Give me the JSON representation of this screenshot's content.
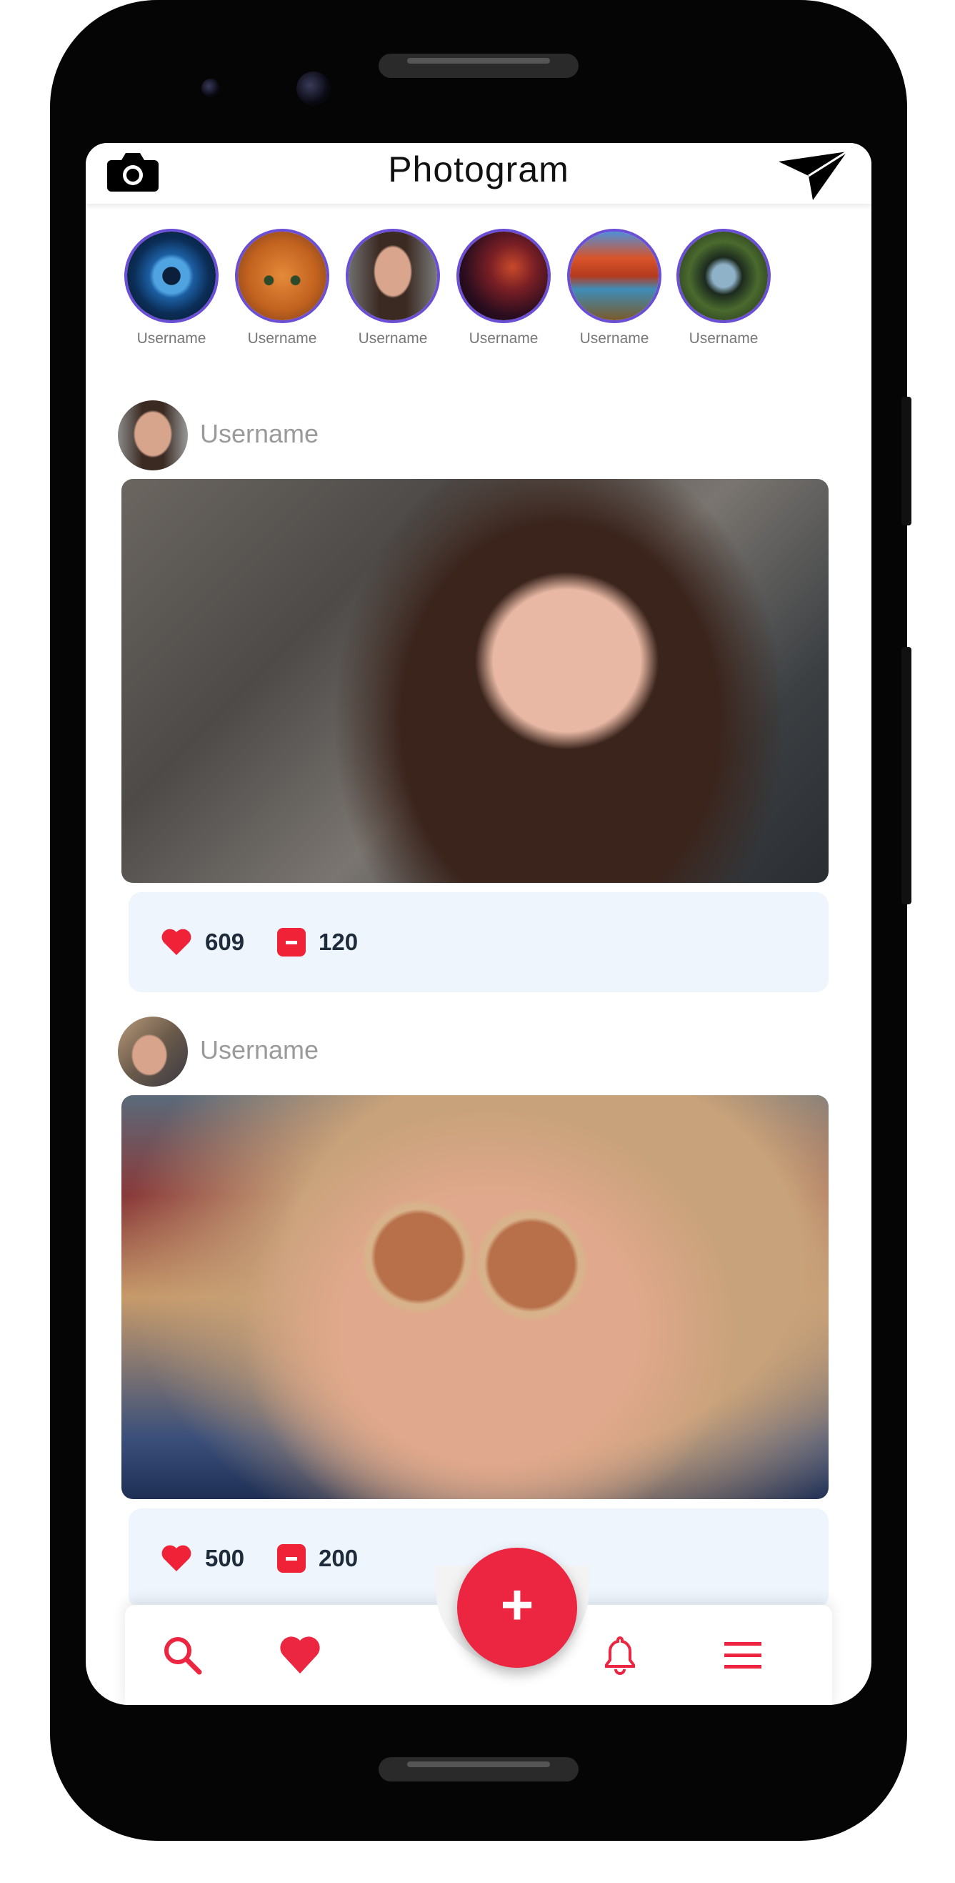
{
  "app": {
    "title": "Photogram"
  },
  "stories": [
    {
      "name": "Username",
      "image": "eye-photo"
    },
    {
      "name": "Username",
      "image": "cat-photo"
    },
    {
      "name": "Username",
      "image": "woman-photo"
    },
    {
      "name": "Username",
      "image": "night-sky-photo"
    },
    {
      "name": "Username",
      "image": "autumn-lake-photo"
    },
    {
      "name": "Username",
      "image": "bridge-reflection-photo"
    }
  ],
  "posts": [
    {
      "username": "Username",
      "likes": "609",
      "comments": "120",
      "image": "woman-portrait-photo"
    },
    {
      "username": "Username",
      "likes": "500",
      "comments": "200",
      "image": "woman-sunglasses-photo"
    }
  ],
  "nav": {
    "items": [
      "search-icon",
      "heart-icon",
      "add-icon",
      "bell-icon",
      "menu-icon"
    ],
    "fab_label": "+"
  },
  "colors": {
    "accent": "#ec2541",
    "story_ring": "#6a4ed6",
    "stats_bg": "#eef5fc"
  }
}
